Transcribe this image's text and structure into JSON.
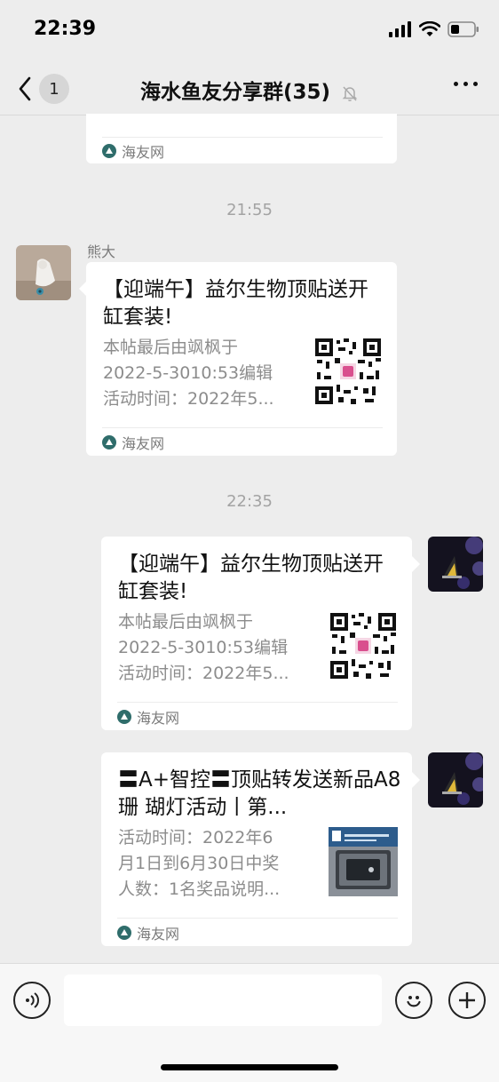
{
  "status": {
    "time": "22:39"
  },
  "nav": {
    "back_count": "1",
    "title": "海水鱼友分享群(35)"
  },
  "source_name": "海友网",
  "messages": [
    {
      "type": "time",
      "text": "21:55"
    },
    {
      "type": "card",
      "side": "left",
      "sender": "熊大",
      "title": "【迎端午】益尔生物顶贴送开缸套装!",
      "desc": [
        "本帖最后由飒枫于",
        "2022-5-3010:53编辑",
        "活动时间：2022年5..."
      ]
    },
    {
      "type": "time",
      "text": "22:35"
    },
    {
      "type": "card",
      "side": "right",
      "title": "【迎端午】益尔生物顶贴送开缸套装!",
      "desc": [
        "本帖最后由飒枫于",
        "2022-5-3010:53编辑",
        "活动时间：2022年5..."
      ]
    },
    {
      "type": "card",
      "side": "right",
      "title": "〓A+智控〓顶贴转发送新品A8珊 瑚灯活动丨第...",
      "desc": [
        "活动时间：2022年6",
        "月1日到6月30日中奖",
        "人数：1名奖品说明..."
      ]
    }
  ],
  "colors": {
    "background": "#ededed",
    "bubble": "#ffffff",
    "meta_text": "#a3a3a3",
    "source_icon": "#2f6d6b"
  }
}
